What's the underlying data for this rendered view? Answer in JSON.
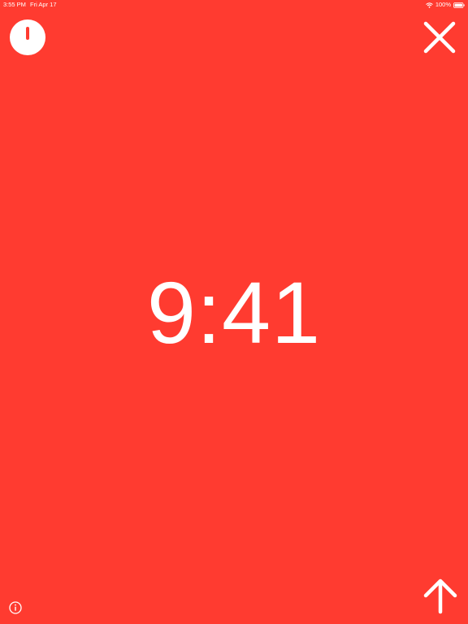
{
  "status_bar": {
    "time": "3:55 PM",
    "date": "Fri Apr 17",
    "battery": "100%",
    "wifi_icon": "wifi-icon",
    "battery_icon": "battery-icon"
  },
  "clock": {
    "time": "9:41"
  },
  "controls": {
    "timer_icon": "timer-icon",
    "close_icon": "close-icon",
    "info_icon": "info-icon",
    "up_arrow_icon": "arrow-up-icon"
  },
  "colors": {
    "background": "#FF3B30",
    "foreground": "#FFFFFF"
  }
}
